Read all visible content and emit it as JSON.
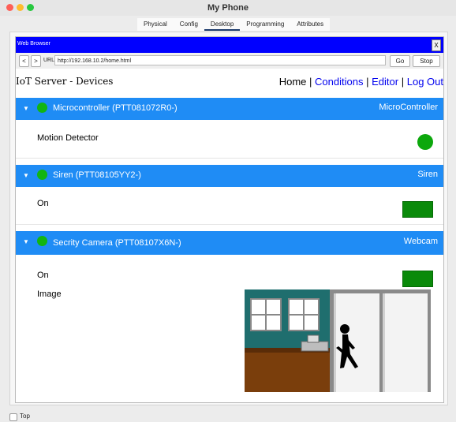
{
  "window": {
    "title": "My Phone"
  },
  "tabs": [
    "Physical",
    "Config",
    "Desktop",
    "Programming",
    "Attributes"
  ],
  "active_tab": "Desktop",
  "browser": {
    "title": "Web Browser",
    "close_label": "X",
    "back_label": "<",
    "forward_label": ">",
    "url_label": "URL",
    "url": "http://192.168.10.2/home.html",
    "go_label": "Go",
    "stop_label": "Stop"
  },
  "page": {
    "title": "IoT Server - Devices",
    "menu": {
      "home": "Home",
      "sep": "|",
      "conditions": "Conditions",
      "editor": "Editor",
      "logout": "Log Out"
    }
  },
  "devices": [
    {
      "name": "Microcontroller (PTT081072R0-)",
      "type": "MicroController",
      "rows": [
        {
          "label": "Motion Detector",
          "indicator": "circle"
        }
      ]
    },
    {
      "name": "Siren (PTT08105YY2-)",
      "type": "Siren",
      "rows": [
        {
          "label": "On",
          "indicator": "rect"
        }
      ]
    },
    {
      "name": "Secrity Camera (PTT08107X6N-)",
      "type": "Webcam",
      "rows": [
        {
          "label": "On",
          "indicator": "rect"
        },
        {
          "label": "Image",
          "indicator": "image"
        }
      ]
    }
  ],
  "colors": {
    "panel_header": "#1f8cf5",
    "status_on": "#12b512",
    "browser_title": "#0000ff",
    "link": "#0000ee"
  },
  "footer": {
    "checkbox_label": "Top"
  }
}
